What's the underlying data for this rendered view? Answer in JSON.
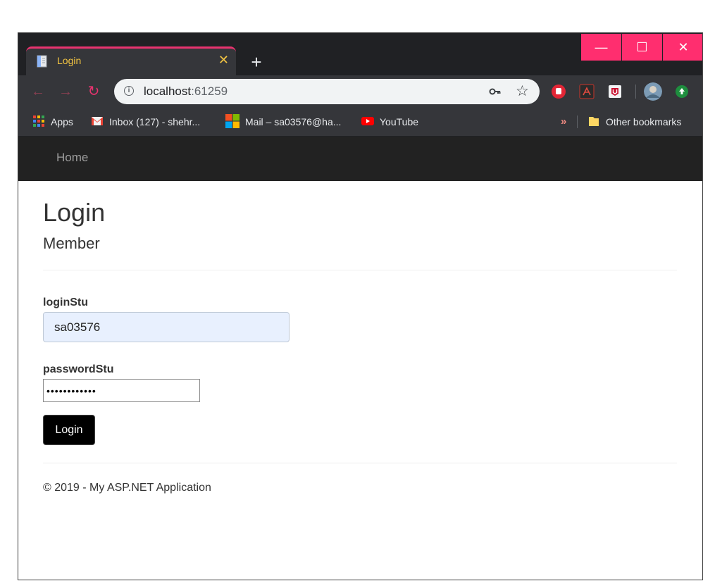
{
  "browser": {
    "tab": {
      "title": "Login",
      "close_glyph": "✕"
    },
    "new_tab_glyph": "+",
    "window_controls": {
      "minimize": "—",
      "maximize": "☐",
      "close": "✕"
    },
    "accent_color": "#ff2e6f",
    "address_bar": {
      "host": "localhost",
      "port": ":61259"
    },
    "toolbar_icons": [
      "back-arrow-icon",
      "forward-arrow-icon",
      "reload-icon",
      "info-icon",
      "key-icon",
      "star-icon"
    ],
    "extensions": [
      "stop-hand-extension-icon",
      "pdf-extension-icon",
      "mcafee-extension-icon",
      "profile-avatar",
      "update-arrow-icon"
    ],
    "bookmarks": {
      "apps": "Apps",
      "inbox": "Inbox (127) - shehr...",
      "mail": "Mail – sa03576@ha...",
      "youtube": "YouTube",
      "overflow": "»",
      "other": "Other bookmarks"
    }
  },
  "page": {
    "nav": {
      "home": "Home"
    },
    "title": "Login",
    "subtitle": "Member",
    "form": {
      "login_label": "loginStu",
      "login_value": "sa03576",
      "password_label": "passwordStu",
      "password_value": "••••••••••••",
      "submit_label": "Login"
    },
    "footer": "© 2019 - My ASP.NET Application"
  }
}
